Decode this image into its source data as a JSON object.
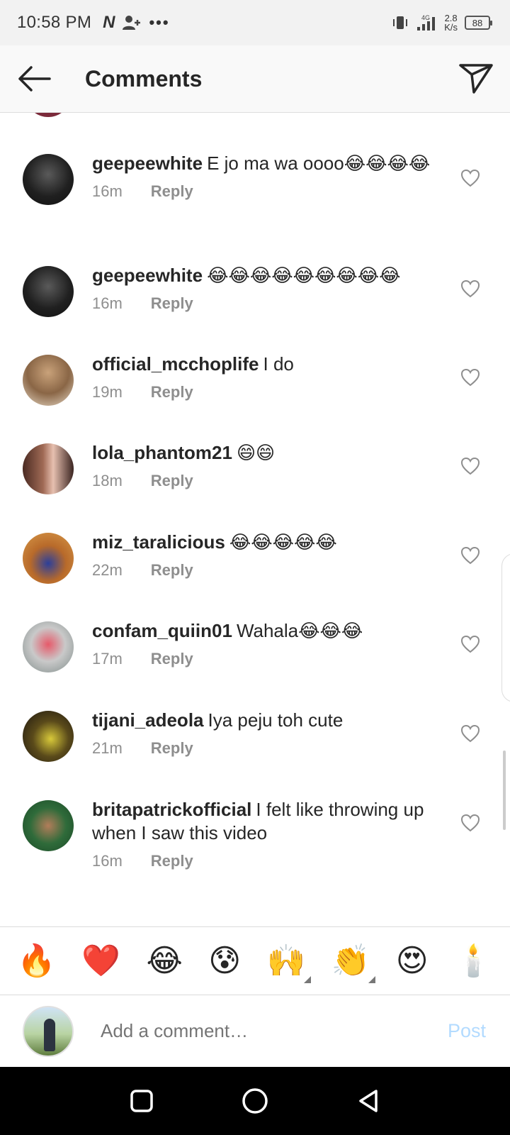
{
  "status_bar": {
    "time": "10:58 PM",
    "network_type": "4G",
    "speed_value": "2.8",
    "speed_unit": "K/s",
    "battery": "88"
  },
  "header": {
    "title": "Comments"
  },
  "comments": [
    {
      "username": "geepeewhite",
      "text": "E jo ma wa oooo😂😂😂😂",
      "time": "16m",
      "reply_label": "Reply"
    },
    {
      "username": "geepeewhite",
      "text": "😂😂😂😂😂😂😂😂😂",
      "time": "16m",
      "reply_label": "Reply"
    },
    {
      "username": "official_mcchoplife",
      "text": "I do",
      "time": "19m",
      "reply_label": "Reply"
    },
    {
      "username": "lola_phantom21",
      "text": "😄😄",
      "time": "18m",
      "reply_label": "Reply"
    },
    {
      "username": "miz_taralicious",
      "text": "😂😂😂😂😂",
      "time": "22m",
      "reply_label": "Reply"
    },
    {
      "username": "confam_quiin01",
      "text": "Wahala😂😂😂",
      "time": "17m",
      "reply_label": "Reply"
    },
    {
      "username": "tijani_adeola",
      "text": "Iya peju toh cute",
      "time": "21m",
      "reply_label": "Reply"
    },
    {
      "username": "britapatrickofficial",
      "text": "I felt like throwing up when I saw this video",
      "time": "16m",
      "reply_label": "Reply"
    }
  ],
  "emoji_bar": [
    "🔥",
    "❤️",
    "😂",
    "😰",
    "🙌",
    "👏",
    "😍",
    "🕯️"
  ],
  "composer": {
    "placeholder": "Add a comment…",
    "post_label": "Post"
  },
  "colors": {
    "text": "#262626",
    "meta": "#8e8e8e",
    "post_disabled": "#b3dbff",
    "nav_bar": "#000000"
  }
}
